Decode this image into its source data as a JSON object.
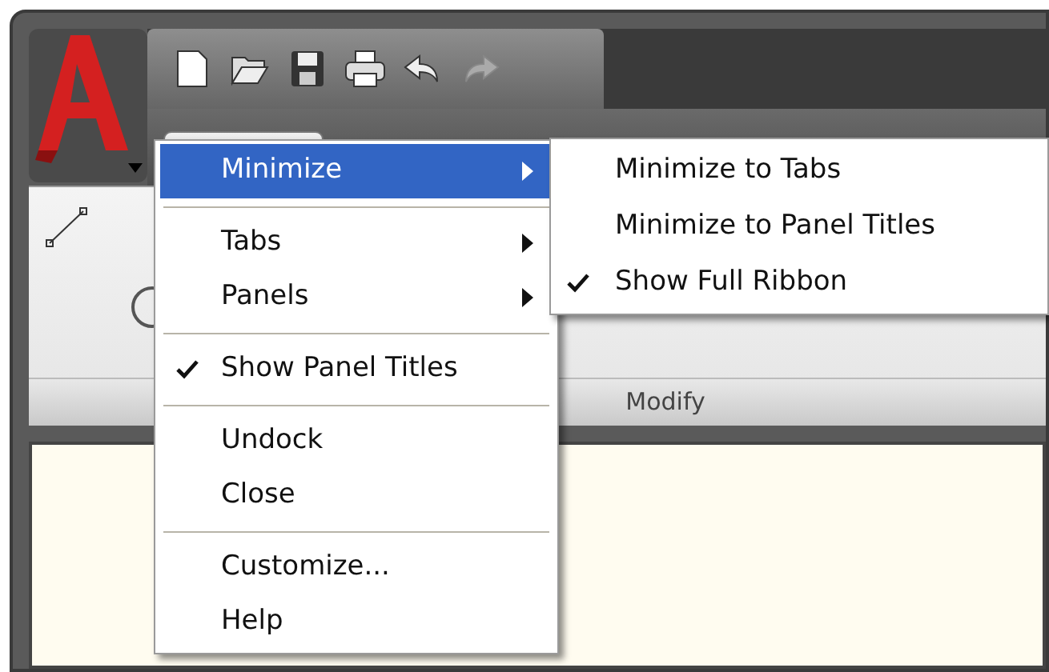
{
  "ribbon": {
    "tabs": [
      {
        "kind": "tab",
        "selected": true
      }
    ],
    "panel_title": "Modify"
  },
  "context_menu": {
    "items": [
      {
        "kind": "item",
        "label": "Minimize",
        "submenu": true,
        "selected": true,
        "checked": false
      },
      {
        "kind": "separator"
      },
      {
        "kind": "item",
        "label": "Tabs",
        "submenu": true,
        "selected": false,
        "checked": false
      },
      {
        "kind": "item",
        "label": "Panels",
        "submenu": true,
        "selected": false,
        "checked": false
      },
      {
        "kind": "separator"
      },
      {
        "kind": "item",
        "label": "Show Panel Titles",
        "submenu": false,
        "selected": false,
        "checked": true
      },
      {
        "kind": "separator"
      },
      {
        "kind": "item",
        "label": "Undock",
        "submenu": false,
        "selected": false,
        "checked": false
      },
      {
        "kind": "item",
        "label": "Close",
        "submenu": false,
        "selected": false,
        "checked": false
      },
      {
        "kind": "separator"
      },
      {
        "kind": "item",
        "label": "Customize...",
        "submenu": false,
        "selected": false,
        "checked": false
      },
      {
        "kind": "item",
        "label": "Help",
        "submenu": false,
        "selected": false,
        "checked": false
      }
    ]
  },
  "submenu": {
    "items": [
      {
        "label": "Minimize to Tabs",
        "checked": false
      },
      {
        "label": "Minimize to Panel Titles",
        "checked": false
      },
      {
        "label": "Show Full Ribbon",
        "checked": true
      }
    ]
  }
}
